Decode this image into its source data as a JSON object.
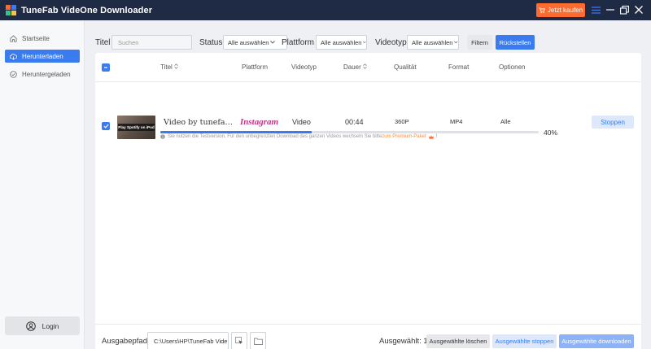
{
  "app": {
    "title": "TuneFab VideOne Downloader",
    "buy_label": "Jetzt kaufen"
  },
  "colors": {
    "accent": "#3a7bf0",
    "buy": "#ff6a2f",
    "titlebar": "#1f2a44",
    "instagram": "#c13584",
    "premium": "#ff8a3d"
  },
  "sidebar": {
    "items": [
      {
        "icon": "home-icon",
        "label": "Startseite"
      },
      {
        "icon": "cloud-download-icon",
        "label": "Herunterladen"
      },
      {
        "icon": "check-circle-icon",
        "label": "Heruntergeladen"
      }
    ],
    "active_index": 1,
    "login_label": "Login"
  },
  "filters": {
    "title_label": "Titel",
    "search_placeholder": "Suchen",
    "status_label": "Status",
    "status_value": "Alle auswählen",
    "platform_label": "Plattform",
    "platform_value": "Alle auswählen",
    "videotype_label": "Videotyp",
    "videotype_value": "Alle auswählen",
    "filter_button": "Filtern",
    "reset_button": "Rückstellen"
  },
  "table": {
    "headers": {
      "title": "Titel",
      "platform": "Plattform",
      "videotype": "Videotyp",
      "duration": "Dauer",
      "quality": "Qualität",
      "format": "Format",
      "options": "Optionen"
    },
    "rows": [
      {
        "thumbnail_text": "Play Spotify on iPod",
        "title": "Video by tunefa…",
        "platform": "Instagram",
        "videotype": "Video",
        "duration": "00:44",
        "quality": "360P",
        "format": "MP4",
        "options": "Alle",
        "progress_percent": 40,
        "progress_label": "40%",
        "stop_label": "Stoppen"
      }
    ]
  },
  "notice": {
    "text": "Sie nutzen die Testversion. Für den unbegrenzten Download des ganzen Videos wechseln Sie bitte",
    "link": "zum Premium-Paket",
    "suffix": "!"
  },
  "footer": {
    "output_label": "Ausgabepfad",
    "output_path": "C:\\Users\\HP\\TuneFab Vide",
    "selected_label": "Ausgewählt: 1",
    "delete_button": "Ausgewählte löschen",
    "stop_button": "Ausgewählte stoppen",
    "download_button": "Ausgewählte downloaden"
  }
}
